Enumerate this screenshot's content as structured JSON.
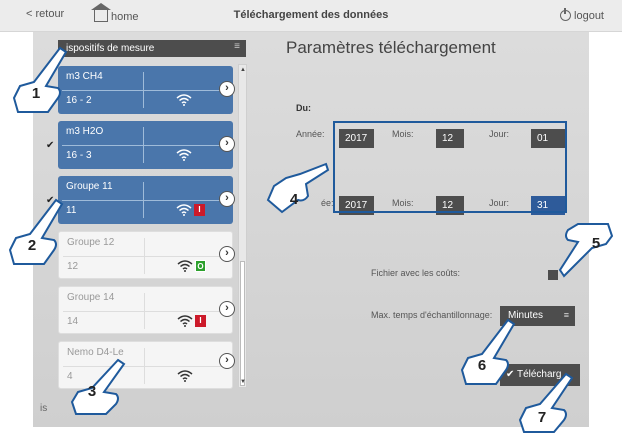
{
  "topbar": {
    "back_label": "retour",
    "home_label": "home",
    "title": "Téléchargement des données",
    "logout_label": "logout"
  },
  "panel": {
    "header": "ispositifs de mesure",
    "menu_icon": "≡",
    "more_label": "is"
  },
  "devices": [
    {
      "name": "m3 CH4",
      "value": "16 - 2",
      "checked": false
    },
    {
      "name": "m3 H2O",
      "value": "16 - 3",
      "checked": true
    },
    {
      "name": "Groupe 11",
      "value": "11",
      "checked": true,
      "badge": "I"
    },
    {
      "name": "Groupe 12",
      "value": "12",
      "checked": false,
      "badge": "O"
    },
    {
      "name": "Groupe 14",
      "value": "14",
      "checked": false,
      "badge": "I"
    },
    {
      "name": "Nemo D4-Le",
      "value": "4",
      "checked": false
    }
  ],
  "form": {
    "title": "Paramètres téléchargement",
    "du_label": "Du:",
    "annee_label": "Année:",
    "annee2_label": "ée:",
    "mois_label": "Mois:",
    "jour_label": "Jour:",
    "from": {
      "annee": "2017",
      "mois": "12",
      "jour": "01"
    },
    "to": {
      "annee": "2017",
      "mois": "12",
      "jour": "31"
    },
    "fichier_label": "Fichier avec les coûts:",
    "max_label": "Max. temps d'échantillonnage:",
    "minutes_value": "Minutes",
    "minutes_menu": "≡",
    "download_label": "✔ Télécharg"
  },
  "callouts": [
    "1",
    "2",
    "3",
    "4",
    "5",
    "6",
    "7"
  ],
  "colors": {
    "accent": "#4a76ab",
    "box_border": "#1f5a9c",
    "red_badge": "#cc1a2a",
    "green_badge": "#2ca02c"
  }
}
